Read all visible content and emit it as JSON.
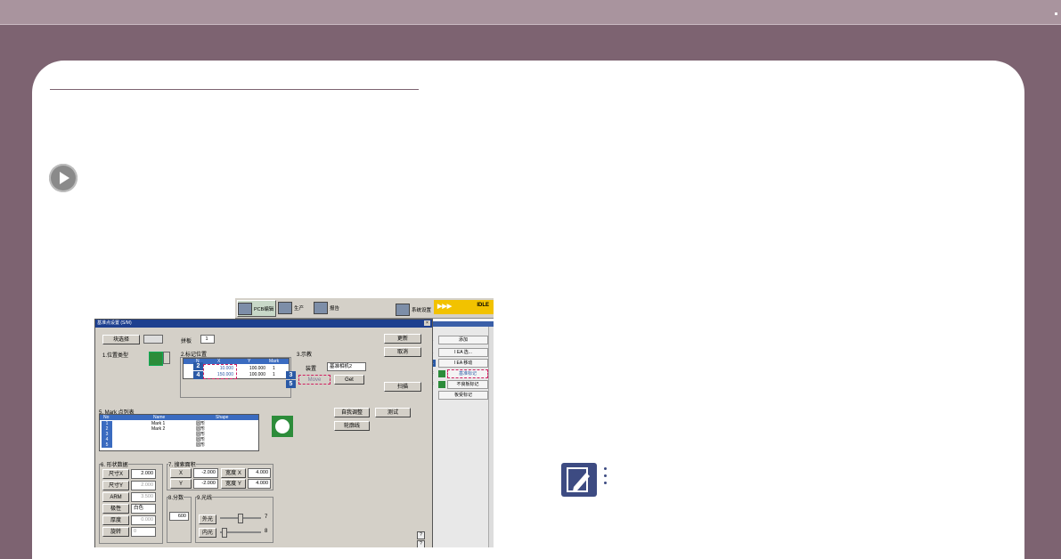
{
  "colors": {
    "band": "#a9949e",
    "header": "#7d6371",
    "accent_blue": "#2b5aa6",
    "idle": "#f2c200",
    "green": "#2c8c3a"
  },
  "toolbar": {
    "pcb": "PCB编辑",
    "produce": "生产",
    "report": "报告",
    "device": "设备",
    "system": "系统设置",
    "idle_arrows": "▶▶▶",
    "idle": "IDLE"
  },
  "right_panel": {
    "rows": [
      {
        "n": "1",
        "text": "添加"
      },
      {
        "n": "1",
        "text": "I EA   选..."
      },
      {
        "n": "",
        "text": "I EA   移动"
      },
      {
        "n": "F",
        "text": "基准标记"
      },
      {
        "n": "F",
        "text": "不良板标记"
      },
      {
        "n": "",
        "text": "板受标记"
      }
    ],
    "badge": "1"
  },
  "dialog": {
    "title": "基准点设置 (S/M)",
    "block_select": "块选择",
    "panel_label": "拼板",
    "panel_value": "1",
    "apply": "更新",
    "cancel": "取消",
    "scan": "扫描",
    "sec1": "1.位置类型",
    "sec2": "2.标记位置",
    "sec3": "3.示教",
    "mark_table": {
      "headers": [
        "N",
        "X",
        "Y",
        "Mark"
      ],
      "rows": [
        {
          "x": "10.000",
          "y": "100.000",
          "mark": "1"
        },
        {
          "x": "150.000",
          "y": "100.000",
          "mark": "1"
        }
      ]
    },
    "teach_label": "装置",
    "teach_select": "基准相机2",
    "move": "Move",
    "get": "Get",
    "sec5": "5. Mark 点列表",
    "list": {
      "headers": [
        "No",
        "Name",
        "Shape"
      ],
      "rows": [
        {
          "no": "1",
          "name": "Mark 1",
          "shape": "圆形"
        },
        {
          "no": "2",
          "name": "Mark 2",
          "shape": "圆形"
        },
        {
          "no": "3",
          "name": "",
          "shape": "圆形"
        },
        {
          "no": "4",
          "name": "",
          "shape": "圆形"
        },
        {
          "no": "5",
          "name": "",
          "shape": "圆形"
        }
      ]
    },
    "auto_adjust": "自我调整",
    "test": "测试",
    "outline": "轮廓线",
    "sec6": "6. 形状数据",
    "shape_fields": [
      {
        "label": "尺寸X",
        "value": "2.000"
      },
      {
        "label": "尺寸Y",
        "value": "2.000"
      },
      {
        "label": "ARM",
        "value": "3.500"
      },
      {
        "label": "极性",
        "value": "白色"
      },
      {
        "label": "厚度",
        "value": "0.000"
      },
      {
        "label": "旋转",
        "value": "0"
      }
    ],
    "sec7": "7. 搜索面积",
    "search": {
      "x_label": "X",
      "x": "-2.000",
      "wx_label": "宽度 X",
      "wx": "4.000",
      "y_label": "Y",
      "y": "-2.000",
      "wy_label": "宽度 Y",
      "wy": "4.000"
    },
    "sec8": "8.分数",
    "score": "600",
    "sec9": "9.光线",
    "outer_light": "外光",
    "outer_val": "7",
    "inner_light": "内光",
    "inner_val": "8",
    "callouts": [
      "2",
      "4",
      "3",
      "5",
      "1"
    ]
  }
}
